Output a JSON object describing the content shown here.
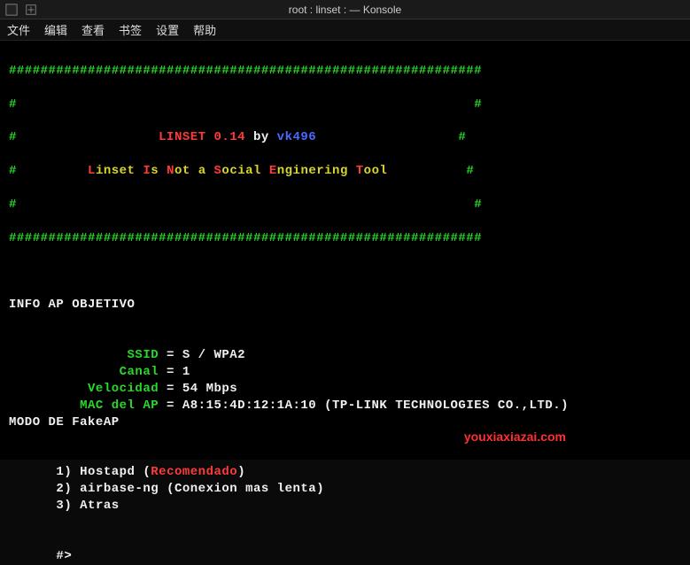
{
  "window": {
    "title": "root : linset : — Konsole"
  },
  "menu": {
    "file": "文件",
    "edit": "编辑",
    "view": "查看",
    "bookmarks": "书签",
    "settings": "设置",
    "help": "帮助"
  },
  "banner": {
    "hash_line": "############################################################",
    "hash_single": "#",
    "title_pre": "LINSET ",
    "version": "0.14",
    "by": " by ",
    "author": "vk496",
    "acronym": {
      "L": "L",
      "inset": "inset ",
      "I": "I",
      "s": "s ",
      "N": "N",
      "ot": "ot ",
      "a": "a ",
      "S": "S",
      "ocial": "ocial ",
      "E": "E",
      "nginering": "nginering ",
      "T": "T",
      "ool": "ool"
    }
  },
  "info": {
    "header": "INFO AP OBJETIVO",
    "ssid_label": "SSID",
    "ssid_value": "S / WPA2",
    "canal_label": "Canal",
    "canal_value": "1",
    "velocidad_label": "Velocidad",
    "velocidad_value": "54 Mbps",
    "mac_label": "MAC del AP",
    "mac_value": "A8:15:4D:12:1A:10",
    "vendor": "(TP-LINK TECHNOLOGIES CO.,LTD.)",
    "eq": " = "
  },
  "fakeap": {
    "header": "MODO DE FakeAP",
    "opt1_num": "1) ",
    "opt1_name": "Hostapd ",
    "opt1_paren_open": "(",
    "opt1_rec": "Recomendado",
    "opt1_paren_close": ")",
    "opt2_num": "2) ",
    "opt2_name": "airbase-ng ",
    "opt2_note": "(Conexion mas lenta)",
    "opt3_num": "3) ",
    "opt3_name": "Atras",
    "prompt": "#>"
  },
  "watermark": "youxiaxiazai.com"
}
